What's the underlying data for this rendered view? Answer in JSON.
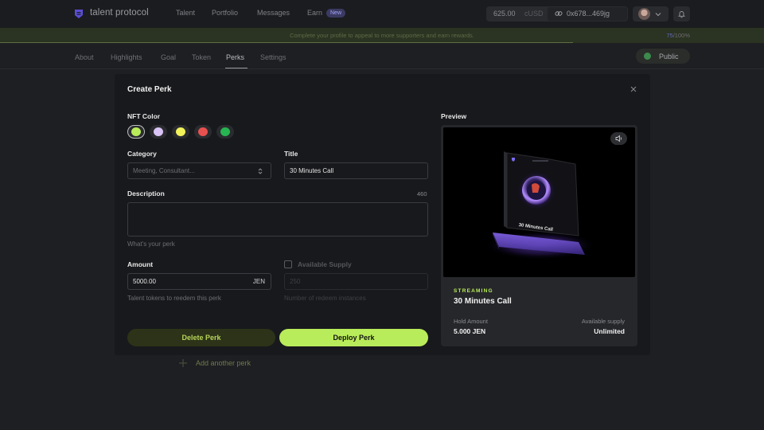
{
  "topnav": {
    "brand": "talent protocol",
    "links": [
      "Talent",
      "Portfolio",
      "Messages",
      "Earn"
    ],
    "earn_badge": "New",
    "balance": "625.00",
    "balance_currency": "cUSD",
    "wallet_address": "0x678...469jg"
  },
  "banner": {
    "text": "Complete your profile to appeal to more supporters and earn rewards.",
    "progress_value": "75",
    "progress_total": "/100%",
    "progress_fraction": 0.75
  },
  "profile_tabs": {
    "items": [
      "About",
      "Highlights",
      "Goal",
      "Token",
      "Perks",
      "Settings"
    ],
    "active": "Perks",
    "visibility_button": "Public"
  },
  "modal": {
    "title": "Create Perk",
    "nft_color_label": "NFT Color",
    "nft_colors": [
      "#b9ec5a",
      "#d9c4f5",
      "#f2f25a",
      "#e8514f",
      "#27b552"
    ],
    "selected_color_index": 0,
    "category_label": "Category",
    "category_placeholder": "Meeting, Consultant...",
    "title_label": "Title",
    "title_value": "30 Minutes Call",
    "description_label": "Description",
    "description_counter": "460",
    "description_value": "",
    "description_helper": "What's your perk",
    "amount_label": "Amount",
    "amount_value": "5000.00",
    "amount_suffix": "JEN",
    "amount_helper": "Talent tokens to reedem this perk",
    "supply_label": "Available Supply",
    "supply_placeholder": "250",
    "supply_helper": "Number of redeem instances",
    "delete_button": "Delete Perk",
    "deploy_button": "Deploy Perk",
    "preview_label": "Preview",
    "preview": {
      "nft_text": "30 Minutes Call",
      "tag": "STREAMING",
      "title": "30 Minutes Call",
      "hold_amount_label": "Hold Amount",
      "hold_amount_value": "5.000 JEN",
      "supply_label": "Available supply",
      "supply_value": "Unlimited"
    }
  },
  "add_another": "Add another perk"
}
